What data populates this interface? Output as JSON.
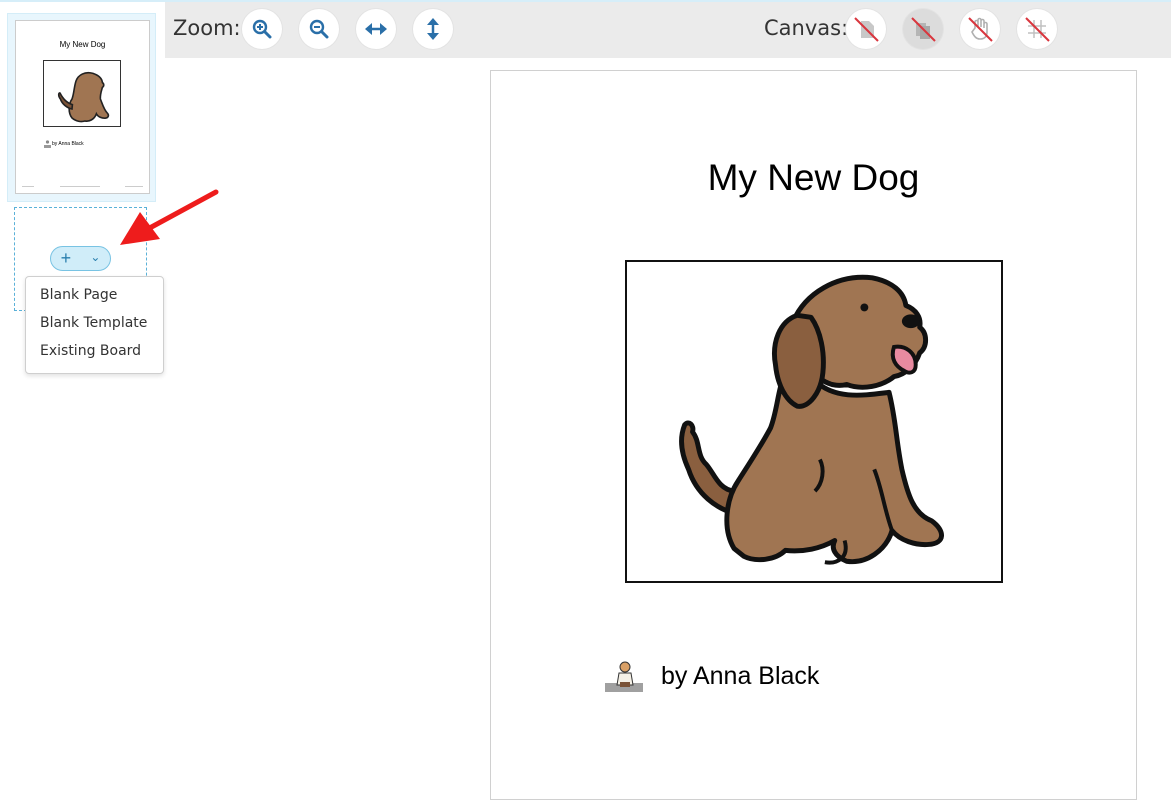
{
  "toolbar": {
    "zoom_label": "Zoom:",
    "canvas_label": "Canvas:",
    "zoom_buttons": [
      "zoom-in-icon",
      "zoom-out-icon",
      "fit-width-icon",
      "fit-height-icon"
    ],
    "canvas_buttons": [
      "canvas-page-off-icon",
      "canvas-pages-off-icon",
      "canvas-hand-off-icon",
      "canvas-grid-off-icon"
    ]
  },
  "sidebar": {
    "thumbnail": {
      "title": "My New Dog",
      "author": "by Anna Black"
    },
    "add_button": {
      "plus": "+",
      "chevron": "⌄"
    },
    "menu": [
      "Blank Page",
      "Blank Template",
      "Existing Board"
    ]
  },
  "page": {
    "title": "My New Dog",
    "author": "by Anna Black"
  },
  "colors": {
    "accent": "#2a6fa8",
    "annotation_arrow": "#ee1c1c",
    "toolbar_bg": "#ebebeb"
  }
}
